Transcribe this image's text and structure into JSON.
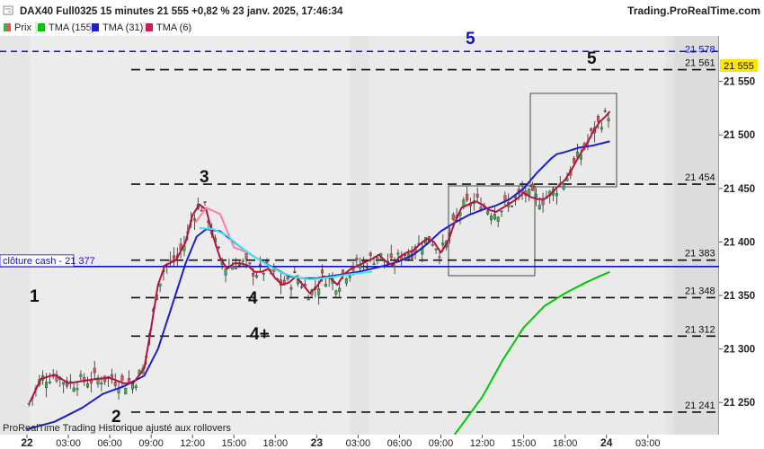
{
  "header": {
    "title": "DAX40 Full0325 15 minutes 21 555 +0,82 % 23 janv. 2025, 17:46:34",
    "site": "Trading.ProRealTime.com"
  },
  "legend": [
    {
      "name": "Prix",
      "color": "#e8505a",
      "color2": "#3cb44b"
    },
    {
      "name": "TMA (155)",
      "color": "#00c800"
    },
    {
      "name": "TMA (31)",
      "color": "#1e1ec8"
    },
    {
      "name": "TMA (6)",
      "color": "#c81e50"
    }
  ],
  "footer": "ProRealTime Trading  Historique ajusté aux rollovers",
  "cash_close_label": "clôture cash -  21 377",
  "chart_data": {
    "type": "line",
    "title": "DAX40 Full0325 15 minutes",
    "x_ticks": [
      {
        "label": "22",
        "bold": true
      },
      {
        "label": "03:00"
      },
      {
        "label": "06:00"
      },
      {
        "label": "09:00"
      },
      {
        "label": "12:00"
      },
      {
        "label": "15:00"
      },
      {
        "label": "18:00"
      },
      {
        "label": "23",
        "bold": true
      },
      {
        "label": "03:00"
      },
      {
        "label": "06:00"
      },
      {
        "label": "09:00"
      },
      {
        "label": "12:00"
      },
      {
        "label": "15:00"
      },
      {
        "label": "18:00"
      },
      {
        "label": "24",
        "bold": true
      },
      {
        "label": "03:00"
      }
    ],
    "y_ticks": [
      21250,
      21300,
      21350,
      21400,
      21450,
      21500,
      21550
    ],
    "y_tick_labels": [
      "21 250",
      "21 300",
      "21 350",
      "21 400",
      "21 450",
      "21 500",
      "21 550"
    ],
    "ylim": [
      21225,
      21595
    ],
    "last_price": {
      "value": 21555,
      "label": "21 555"
    },
    "cash_close": 21377,
    "levels": [
      {
        "value": 21578,
        "label": "21 578",
        "style": "blue"
      },
      {
        "value": 21561,
        "label": "21 561"
      },
      {
        "value": 21454,
        "label": "21 454"
      },
      {
        "value": 21383,
        "label": "21 383"
      },
      {
        "value": 21348,
        "label": "21 348"
      },
      {
        "value": 21312,
        "label": "21 312"
      },
      {
        "value": 21241,
        "label": "21 241"
      }
    ],
    "annotations": [
      "1",
      "2",
      "3",
      "4",
      "4+",
      "5",
      "5"
    ],
    "series": [
      {
        "name": "TMA (155)",
        "color": "#00c800",
        "points": [
          [
            31,
            21220
          ],
          [
            33,
            21255
          ],
          [
            34.5,
            21290
          ],
          [
            36,
            21320
          ],
          [
            37.5,
            21340
          ],
          [
            39,
            21352
          ],
          [
            40.5,
            21362
          ],
          [
            41.5,
            21368
          ],
          [
            42.25,
            21372
          ]
        ]
      },
      {
        "name": "TMA (31)",
        "color": "#1e1ec8",
        "points": [
          [
            0,
            21225
          ],
          [
            2,
            21232
          ],
          [
            4,
            21245
          ],
          [
            5.5,
            21258
          ],
          [
            7,
            21265
          ],
          [
            8.5,
            21275
          ],
          [
            9.5,
            21300
          ],
          [
            10.5,
            21340
          ],
          [
            11.5,
            21380
          ],
          [
            12.3,
            21405
          ],
          [
            13,
            21412
          ],
          [
            14,
            21410
          ],
          [
            15,
            21400
          ],
          [
            16,
            21390
          ],
          [
            17,
            21382
          ],
          [
            18,
            21375
          ],
          [
            19,
            21368
          ],
          [
            20,
            21366
          ],
          [
            21,
            21366
          ],
          [
            22,
            21368
          ],
          [
            23,
            21370
          ],
          [
            24,
            21372
          ],
          [
            25,
            21375
          ],
          [
            26,
            21378
          ],
          [
            27,
            21382
          ],
          [
            28,
            21388
          ],
          [
            29,
            21398
          ],
          [
            30,
            21410
          ],
          [
            31,
            21418
          ],
          [
            32,
            21425
          ],
          [
            33,
            21430
          ],
          [
            34,
            21434
          ],
          [
            35,
            21440
          ],
          [
            36,
            21450
          ],
          [
            37,
            21465
          ],
          [
            38,
            21478
          ],
          [
            38.4,
            21482
          ],
          [
            39,
            21484
          ],
          [
            40,
            21488
          ],
          [
            41,
            21490
          ],
          [
            42.25,
            21494
          ]
        ]
      },
      {
        "name": "TMA (6)",
        "color": "#b4143c",
        "points": [
          [
            0.2,
            21250
          ],
          [
            1,
            21272
          ],
          [
            2,
            21276
          ],
          [
            3,
            21268
          ],
          [
            4,
            21270
          ],
          [
            5,
            21272
          ],
          [
            6,
            21273
          ],
          [
            7,
            21268
          ],
          [
            7.7,
            21268
          ],
          [
            8.5,
            21282
          ],
          [
            9,
            21320
          ],
          [
            9.5,
            21360
          ],
          [
            10,
            21378
          ],
          [
            10.8,
            21383
          ],
          [
            11.5,
            21400
          ],
          [
            12,
            21425
          ],
          [
            12.5,
            21435
          ],
          [
            13,
            21430
          ],
          [
            13.5,
            21405
          ],
          [
            14,
            21385
          ],
          [
            14.5,
            21375
          ],
          [
            15,
            21380
          ],
          [
            15.5,
            21380
          ],
          [
            16,
            21378
          ],
          [
            16.5,
            21372
          ],
          [
            17,
            21372
          ],
          [
            17.5,
            21375
          ],
          [
            18,
            21366
          ],
          [
            18.5,
            21360
          ],
          [
            19,
            21362
          ],
          [
            19.5,
            21368
          ],
          [
            20,
            21360
          ],
          [
            20.5,
            21352
          ],
          [
            21,
            21358
          ],
          [
            21.5,
            21368
          ],
          [
            22,
            21366
          ],
          [
            22.5,
            21360
          ],
          [
            23,
            21370
          ],
          [
            23.5,
            21375
          ],
          [
            24,
            21378
          ],
          [
            24.5,
            21381
          ],
          [
            25,
            21384
          ],
          [
            25.5,
            21388
          ],
          [
            26,
            21382
          ],
          [
            26.5,
            21378
          ],
          [
            27,
            21386
          ],
          [
            27.5,
            21390
          ],
          [
            28,
            21392
          ],
          [
            28.5,
            21398
          ],
          [
            29,
            21403
          ],
          [
            29.5,
            21400
          ],
          [
            30,
            21390
          ],
          [
            30.5,
            21400
          ],
          [
            31,
            21418
          ],
          [
            31.5,
            21432
          ],
          [
            32,
            21435
          ],
          [
            32.5,
            21438
          ],
          [
            33,
            21435
          ],
          [
            33.5,
            21430
          ],
          [
            34,
            21428
          ],
          [
            34.5,
            21432
          ],
          [
            35,
            21436
          ],
          [
            35.5,
            21440
          ],
          [
            36,
            21446
          ],
          [
            36.5,
            21442
          ],
          [
            37,
            21440
          ],
          [
            37.5,
            21440
          ],
          [
            38,
            21445
          ],
          [
            38.2,
            21448
          ],
          [
            38.5,
            21452
          ],
          [
            39,
            21458
          ],
          [
            39.5,
            21468
          ],
          [
            40,
            21480
          ],
          [
            40.5,
            21490
          ],
          [
            41,
            21502
          ],
          [
            41.5,
            21512
          ],
          [
            42,
            21518
          ],
          [
            42.25,
            21522
          ]
        ]
      },
      {
        "name": "TMA (31) pink",
        "color": "#ff7ca0",
        "points": [
          [
            12.2,
            21418
          ],
          [
            13,
            21432
          ],
          [
            14,
            21426
          ],
          [
            15,
            21395
          ],
          [
            16,
            21390
          ],
          [
            17,
            21382
          ]
        ]
      },
      {
        "name": "TMA (31) cyan",
        "color": "#3ce6f0",
        "points": [
          [
            12.5,
            21413
          ],
          [
            13.5,
            21412
          ],
          [
            14.5,
            21406
          ],
          [
            15.5,
            21395
          ],
          [
            16.5,
            21386
          ],
          [
            17.5,
            21378
          ],
          [
            18.5,
            21371
          ],
          [
            19.5,
            21367
          ],
          [
            20.5,
            21365
          ],
          [
            21.5,
            21366
          ],
          [
            22.5,
            21368
          ],
          [
            23.5,
            21370
          ],
          [
            24.2,
            21371
          ],
          [
            25,
            21372
          ]
        ]
      }
    ]
  }
}
